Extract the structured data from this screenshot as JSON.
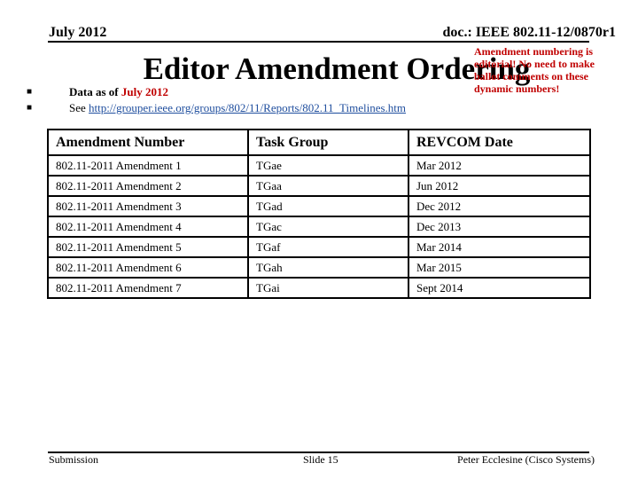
{
  "header": {
    "date": "July 2012",
    "doc_id": "doc.: IEEE 802.11-12/0870r1"
  },
  "title": "Editor Amendment Ordering",
  "note": "Amendment numbering is editorial! No need to make ballot comments on these dynamic numbers!",
  "bullets": {
    "data_as_of_prefix": "Data as of ",
    "data_as_of_date": "July 2012",
    "see_prefix": "See ",
    "see_link": "http://grouper.ieee.org/groups/802/11/Reports/802.11_Timelines.htm"
  },
  "table": {
    "headers": [
      "Amendment Number",
      "Task Group",
      "REVCOM Date"
    ],
    "rows": [
      [
        "802.11-2011 Amendment 1",
        "TGae",
        "Mar 2012"
      ],
      [
        "802.11-2011 Amendment 2",
        "TGaa",
        "Jun 2012"
      ],
      [
        "802.11-2011 Amendment 3",
        "TGad",
        "Dec 2012"
      ],
      [
        "802.11-2011 Amendment 4",
        "TGac",
        "Dec 2013"
      ],
      [
        "802.11-2011 Amendment 5",
        "TGaf",
        "Mar 2014"
      ],
      [
        "802.11-2011 Amendment 6",
        "TGah",
        "Mar 2015"
      ],
      [
        "802.11-2011 Amendment 7",
        "TGai",
        "Sept 2014"
      ]
    ]
  },
  "footer": {
    "left": "Submission",
    "center": "Slide 15",
    "right": "Peter Ecclesine (Cisco Systems)"
  },
  "colors": {
    "accent_red": "#c00000",
    "link_blue": "#1f4e9e"
  }
}
